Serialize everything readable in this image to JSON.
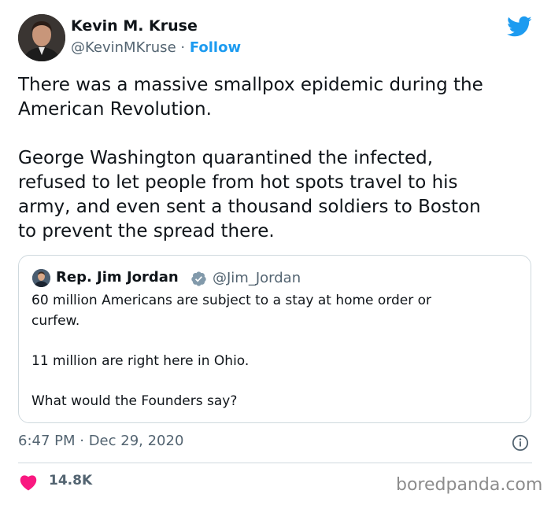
{
  "author": {
    "name": "Kevin M. Kruse",
    "handle": "@KevinMKruse",
    "separator": " · ",
    "follow_label": "Follow"
  },
  "tweet": {
    "text": "There was a massive smallpox epidemic during the\nAmerican Revolution.\n\nGeorge Washington quarantined the infected,\nrefused to let people from hot spots travel to his\narmy, and even sent a thousand soldiers to Boston\nto prevent the spread there."
  },
  "quoted": {
    "name": "Rep. Jim Jordan",
    "handle": "@Jim_Jordan",
    "text": "60 million Americans are subject to a stay at home order or\ncurfew.\n\n11 million are right here in Ohio.\n\nWhat would the Founders say?"
  },
  "meta": {
    "timestamp": "6:47 PM · Dec 29, 2020"
  },
  "engagement": {
    "likes": "14.8K"
  },
  "watermark": "boredpanda.com",
  "icons": {
    "brand": "twitter-bird-icon",
    "verified": "verified-badge-icon",
    "info": "info-icon",
    "like": "heart-icon"
  },
  "colors": {
    "accent": "#1d9bf0",
    "like": "#f91880",
    "muted": "#536471",
    "border": "#cfd9de"
  }
}
